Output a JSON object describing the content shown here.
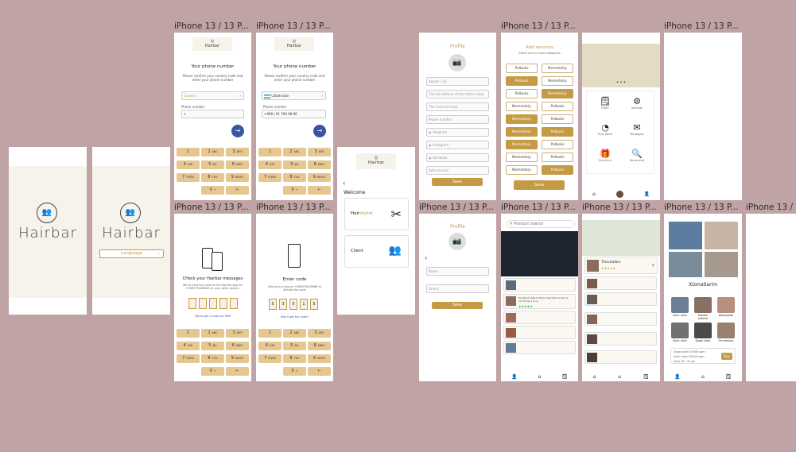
{
  "frame_label": "iPhone 13 / 13 P...",
  "frame_label_cut": "iPhone 13 / 1",
  "brand": {
    "name": "Hairbar",
    "gold": "#c49a45",
    "blue": "#3956a0",
    "canvas_bg": "#bfa3a5"
  },
  "splash": {
    "language_label": "Language"
  },
  "phone_screen": {
    "title": "Your phone number",
    "subtitle": "Please confirm your country code and enter your phone number",
    "country_placeholder": "Country",
    "phone_label": "Phone number",
    "phone_prefix": "+",
    "country_selected": "Uzbekistan",
    "phone_prefix_filled": "+998",
    "phone_number": "91 790 08 96"
  },
  "keypad": [
    {
      "n": "1",
      "s": ""
    },
    {
      "n": "2",
      "s": "ABC"
    },
    {
      "n": "3",
      "s": "DEF"
    },
    {
      "n": "4",
      "s": "GHI"
    },
    {
      "n": "5",
      "s": "JKL"
    },
    {
      "n": "6",
      "s": "MNO"
    },
    {
      "n": "7",
      "s": "PQRS"
    },
    {
      "n": "8",
      "s": "TUV"
    },
    {
      "n": "9",
      "s": "WXYZ"
    },
    {
      "n": "",
      "s": ""
    },
    {
      "n": "0",
      "s": "+"
    },
    {
      "n": "←",
      "s": ""
    }
  ],
  "check_messages": {
    "title": "CHeck your Hairbar messages",
    "body": "We've sent the code to the Hairbar app for +998979008966 on your other device.",
    "link": "Tap to get a code via SMS"
  },
  "enter_code": {
    "title": "Enter code",
    "body": "Calling to a phone +998979008966 to dictate the code",
    "digits": [
      "5",
      "3",
      "5",
      "1",
      "5"
    ],
    "link": "didn't get the code?"
  },
  "welcome": {
    "title": "Welcome",
    "hairstylist_prefix": "Hair",
    "hairstylist_suffix": "stylist",
    "client": "Client"
  },
  "profile": {
    "title": "Profile",
    "fields": [
      "Region City",
      "The full address of the hotter shop",
      "The name of shop",
      "Phone number",
      "Telegram",
      "Instagram",
      "Facebook",
      "Add services"
    ],
    "save": "Save",
    "client_fields": [
      "Name",
      "Family"
    ]
  },
  "services": {
    "title": "Add services",
    "subtitle": "Select one or more categories",
    "chips": [
      {
        "label": "Polboks",
        "sel": false
      },
      {
        "label": "Nemetskiy",
        "sel": false
      },
      {
        "label": "Polboks",
        "sel": true
      },
      {
        "label": "Nemetskiy",
        "sel": false
      },
      {
        "label": "Polboks",
        "sel": false
      },
      {
        "label": "Nemetskiy",
        "sel": true
      },
      {
        "label": "Nemetskiy",
        "sel": false
      },
      {
        "label": "Polboks",
        "sel": false
      },
      {
        "label": "Nemetskiy",
        "sel": true
      },
      {
        "label": "Polboks",
        "sel": false
      },
      {
        "label": "Nemetskiy",
        "sel": true
      },
      {
        "label": "Polboks",
        "sel": true
      },
      {
        "label": "Nemetskiy",
        "sel": true
      },
      {
        "label": "Polboks",
        "sel": false
      },
      {
        "label": "Nemetskiy",
        "sel": false
      },
      {
        "label": "Polboks",
        "sel": false
      },
      {
        "label": "Nemetskiy",
        "sel": false
      },
      {
        "label": "Polboks",
        "sel": true
      }
    ],
    "save": "Save"
  },
  "dashboard": {
    "items": [
      "Order",
      "Settings",
      "Time Saver",
      "Messages",
      "Directory",
      "Recomend"
    ],
    "dots": "• • •"
  },
  "map_list": {
    "search": "Product search",
    "card_title": "Toshkent shahar Mirzo Ulug'bek tumani O ichi Kicha 1 Ҳ uy"
  },
  "barber": {
    "title": "Tima barber",
    "rating": "★★★★★"
  },
  "services_page": {
    "title": "Xizmatlarim",
    "items": [
      "Soch olish",
      "Mushni oldirish",
      "Massajnoe",
      "Soch olish",
      "Soqol olish",
      "Omvlenlou"
    ],
    "price_lines": [
      "Soqol olish   20000 som",
      "Soch olish   20000 som",
      "Soat 16 : 15 ga"
    ],
    "button": "Buy"
  }
}
